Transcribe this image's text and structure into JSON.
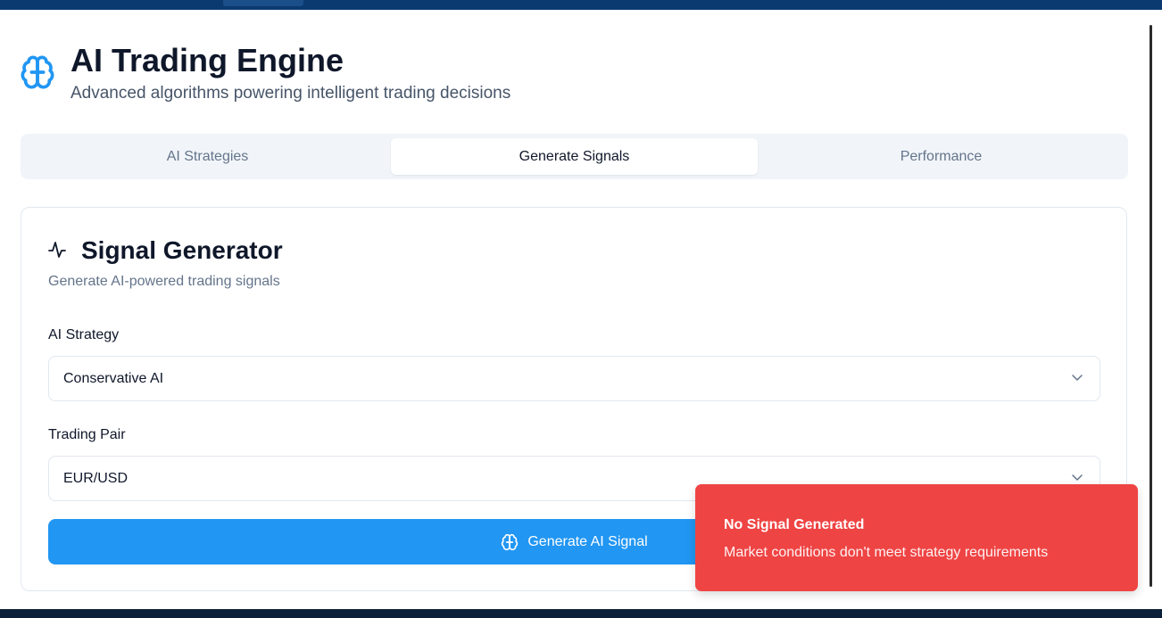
{
  "header": {
    "icon": "brain-icon",
    "title": "AI Trading Engine",
    "subtitle": "Advanced algorithms powering intelligent trading decisions"
  },
  "tabs": [
    {
      "label": "AI Strategies",
      "active": false
    },
    {
      "label": "Generate Signals",
      "active": true
    },
    {
      "label": "Performance",
      "active": false
    }
  ],
  "signal_generator": {
    "icon": "activity-icon",
    "title": "Signal Generator",
    "description": "Generate AI-powered trading signals",
    "strategy": {
      "label": "AI Strategy",
      "value": "Conservative AI",
      "icon": "chevron-down-icon"
    },
    "pair": {
      "label": "Trading Pair",
      "value": "EUR/USD",
      "icon": "chevron-down-icon"
    },
    "generate_button": {
      "label": "Generate AI Signal",
      "icon": "brain-icon"
    }
  },
  "toast": {
    "title": "No Signal Generated",
    "message": "Market conditions don't meet strategy requirements"
  },
  "colors": {
    "primary": "#2196f3",
    "header_icon": "#2196f3",
    "toast_bg": "#ef4444",
    "topbar": "#0b3a70"
  }
}
